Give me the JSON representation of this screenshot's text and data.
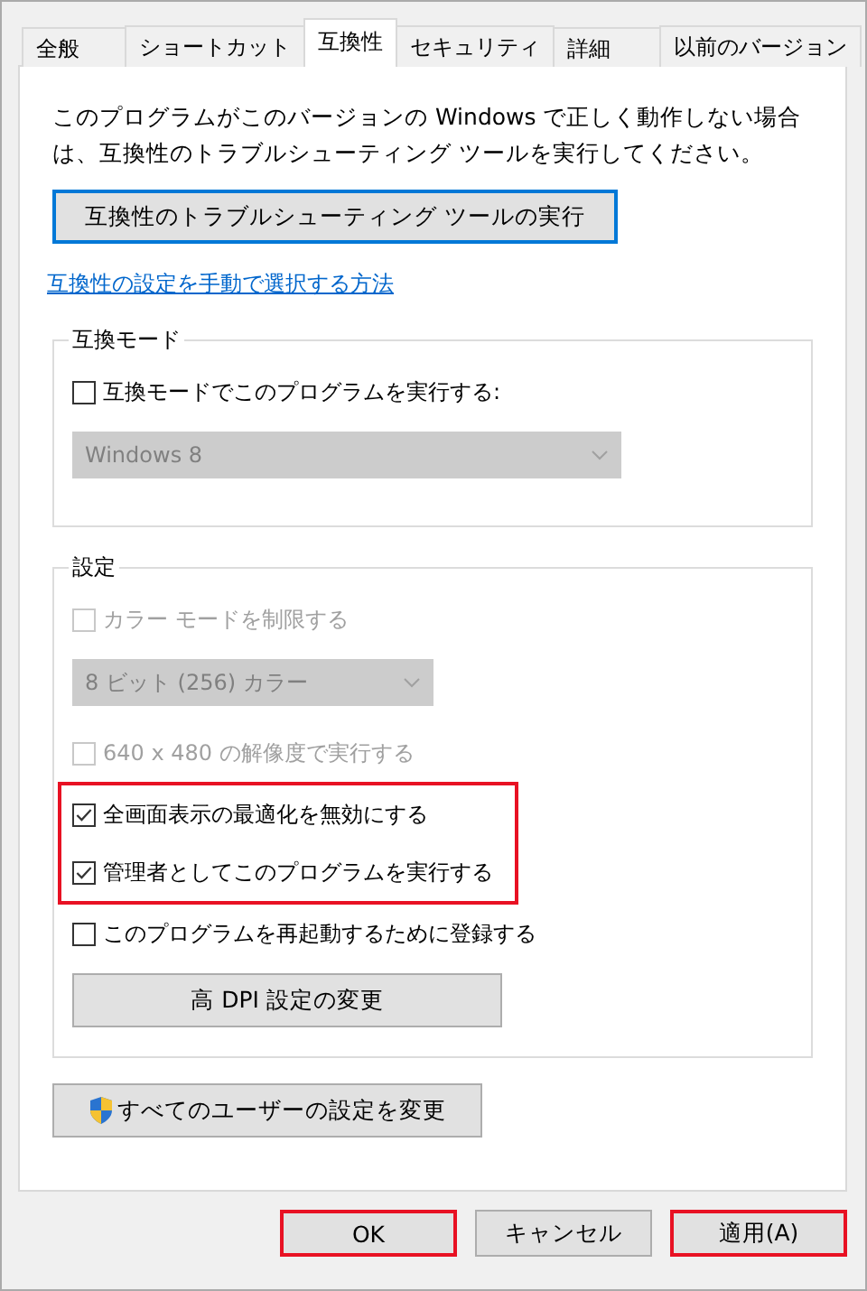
{
  "tabs": [
    {
      "label": "全般",
      "selected": false
    },
    {
      "label": "ショートカット",
      "selected": false
    },
    {
      "label": "互換性",
      "selected": true
    },
    {
      "label": "セキュリティ",
      "selected": false
    },
    {
      "label": "詳細",
      "selected": false
    },
    {
      "label": "以前のバージョン",
      "selected": false
    }
  ],
  "intro": "このプログラムがこのバージョンの Windows で正しく動作しない場合は、互換性のトラブルシューティング ツールを実行してください。",
  "troubleshoot_button": {
    "label": "互換性のトラブルシューティング ツールの実行",
    "focused": true
  },
  "help_link": "互換性の設定を手動で選択する方法",
  "compat_mode": {
    "title": "互換モード",
    "items": [
      {
        "kind": "checkbox",
        "label": "互換モードでこのプログラムを実行する:",
        "checked": false,
        "disabled": false,
        "highlighted": false
      },
      {
        "kind": "dropdown",
        "value": "Windows 8",
        "disabled": true
      }
    ]
  },
  "settings": {
    "title": "設定",
    "items": [
      {
        "kind": "checkbox",
        "label": "カラー モードを制限する",
        "checked": false,
        "disabled": true,
        "highlighted": false
      },
      {
        "kind": "dropdown",
        "value": "8 ビット (256) カラー",
        "disabled": true
      },
      {
        "kind": "checkbox",
        "label": "640 x 480 の解像度で実行する",
        "checked": false,
        "disabled": true,
        "highlighted": false
      },
      {
        "kind": "checkbox",
        "label": "全画面表示の最適化を無効にする",
        "checked": true,
        "disabled": false,
        "highlighted": true
      },
      {
        "kind": "checkbox",
        "label": "管理者としてこのプログラムを実行する",
        "checked": true,
        "disabled": false,
        "highlighted": true
      },
      {
        "kind": "checkbox",
        "label": "このプログラムを再起動するために登録する",
        "checked": false,
        "disabled": false,
        "highlighted": false
      },
      {
        "kind": "button",
        "label": "高 DPI 設定の変更"
      }
    ]
  },
  "all_users_button": {
    "label": "すべてのユーザーの設定を変更"
  },
  "buttons": [
    {
      "label": "OK",
      "highlighted": true
    },
    {
      "label": "キャンセル",
      "highlighted": false
    },
    {
      "label": "適用(A)",
      "highlighted": true
    }
  ]
}
